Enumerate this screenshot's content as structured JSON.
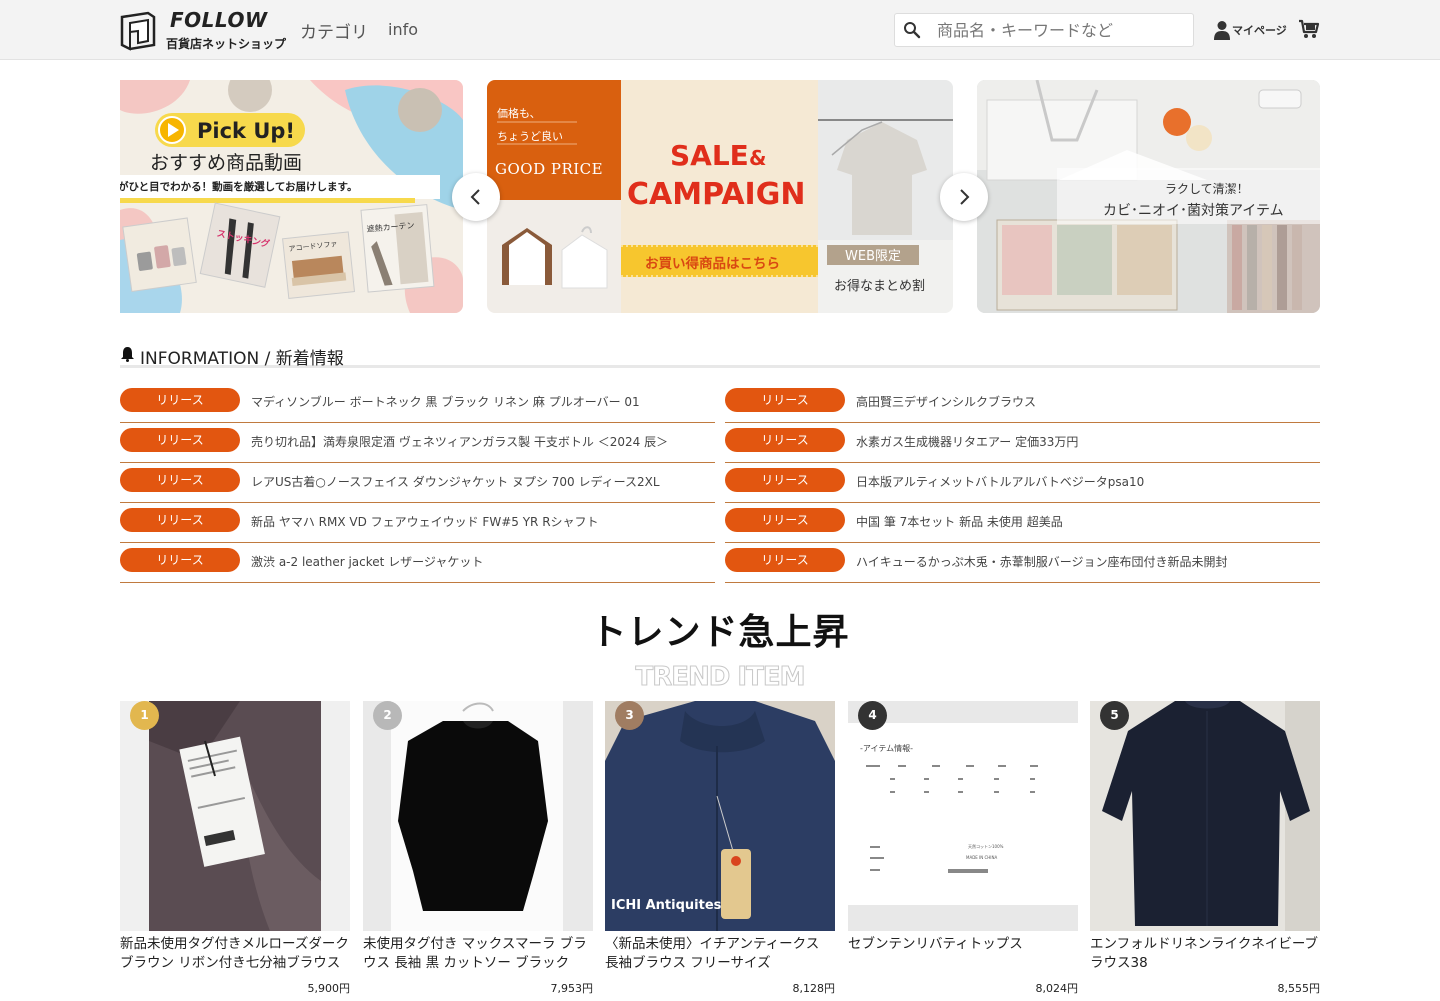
{
  "header": {
    "logo_title": "FOLLOW",
    "logo_subtitle": "百貨店ネットショップ",
    "nav": {
      "category": "カテゴリ",
      "info": "info"
    },
    "search_placeholder": "商品名・キーワードなど",
    "mypage": "マイページ"
  },
  "banners": {
    "left": {
      "badge": "Pick Up!",
      "title": "おすすめ商品動画",
      "caption": "がひと目でわかる！動画を厳選してお届けします。",
      "thumb1": "ストッキング",
      "thumb2": "遮熱カーテン",
      "thumb3": "アコードソファ"
    },
    "middle": {
      "price_line1": "価格も、",
      "price_line2": "ちょうど良い",
      "good_price": "GOOD PRICE",
      "sale": "SALE",
      "amp": "&",
      "campaign": "CAMPAIGN",
      "deal": "お買い得商品はこちら",
      "web_only": "WEB限定",
      "bundle": "お得なまとめ割"
    },
    "right": {
      "line1": "ラクして清潔！",
      "line2": "カビ･ニオイ･菌対策アイテム"
    }
  },
  "info": {
    "title": "INFORMATION / 新着情報",
    "left": [
      {
        "badge": "リリース",
        "text": "マディソンブルー ボートネック 黒 ブラック リネン 麻 プルオーバー 01"
      },
      {
        "badge": "リリース",
        "text": "売り切れ品】満寿泉限定酒 ヴェネツィアンガラス製 干支ボトル ＜2024 辰＞"
      },
      {
        "badge": "リリース",
        "text": "レアUS古着○ノースフェイス ダウンジャケット ヌプシ 700 レディース2XL"
      },
      {
        "badge": "リリース",
        "text": "新品 ヤマハ RMX VD フェアウェイウッド FW#5 YR Rシャフト"
      },
      {
        "badge": "リリース",
        "text": "激渋 a-2 leather jacket レザージャケット"
      }
    ],
    "right": [
      {
        "badge": "リリース",
        "text": "高田賢三デザインシルクブラウス"
      },
      {
        "badge": "リリース",
        "text": "水素ガス生成機器リタエアー 定価33万円"
      },
      {
        "badge": "リリース",
        "text": "日本版アルティメットバトルアルバトベジータpsa10"
      },
      {
        "badge": "リリース",
        "text": "中国 筆 7本セット 新品 未使用 超美品"
      },
      {
        "badge": "リリース",
        "text": "ハイキューるかっぷ木兎・赤葦制服バージョン座布団付き新品未開封"
      }
    ]
  },
  "trend": {
    "title": "トレンド急上昇",
    "subtitle": "TREND ITEM",
    "products": [
      {
        "rank": "1",
        "name": "新品未使用タグ付きメルローズダークブラウン リボン付き七分袖ブラウス",
        "price": "5,900円"
      },
      {
        "rank": "2",
        "name": "未使用タグ付き マックスマーラ ブラウス 長袖 黒 カットソー ブラック",
        "price": "7,953円"
      },
      {
        "rank": "3",
        "name": "〈新品未使用〉イチアンティークス 長袖ブラウス フリーサイズ",
        "price": "8,128円",
        "overlay": "ICHI Antiquites"
      },
      {
        "rank": "4",
        "name": "セブンテンリバティトップス",
        "price": "8,024円",
        "sheet_title": "-アイテム情報-",
        "sheet_origin": "MADE IN CHINA",
        "sheet_material": "天然コットン100%"
      },
      {
        "rank": "5",
        "name": "エンフォルドリネンライクネイビーブラウス38",
        "price": "8,555円"
      }
    ]
  },
  "colors": {
    "accent": "#e25610",
    "rank1": "#e2b74f",
    "rank2": "#b8b8b8",
    "rank3": "#a07d62",
    "rank4": "#333333",
    "rank5": "#333333"
  }
}
